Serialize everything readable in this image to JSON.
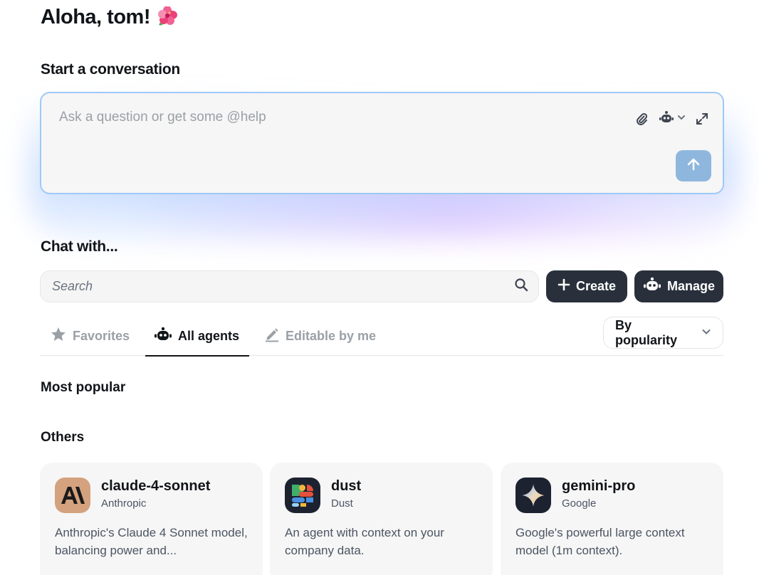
{
  "greeting": {
    "text": "Aloha, tom!",
    "emoji_icon": "hibiscus-icon"
  },
  "composer": {
    "section_title": "Start a conversation",
    "placeholder": "Ask a question or get some @help",
    "tools": [
      "paperclip-icon",
      "robot-icon",
      "chevron-down-icon",
      "expand-icon"
    ],
    "send_icon": "arrow-up-icon"
  },
  "chat_with": {
    "section_title": "Chat with...",
    "search_placeholder": "Search",
    "create_label": "Create",
    "manage_label": "Manage"
  },
  "tabs": [
    {
      "label": "Favorites",
      "icon": "star-icon",
      "active": false
    },
    {
      "label": "All agents",
      "icon": "robot-icon",
      "active": true
    },
    {
      "label": "Editable by me",
      "icon": "pencil-icon",
      "active": false
    }
  ],
  "sort": {
    "label": "By popularity"
  },
  "groups": {
    "most_popular": "Most popular",
    "others": "Others"
  },
  "agents": [
    {
      "name": "claude-4-sonnet",
      "vendor": "Anthropic",
      "description": "Anthropic's Claude 4 Sonnet model, balancing power and...",
      "avatar_color": "#d4a27f"
    },
    {
      "name": "dust",
      "vendor": "Dust",
      "description": "An agent with context on your company data.",
      "avatar_color": "#1c2230"
    },
    {
      "name": "gemini-pro",
      "vendor": "Google",
      "description": "Google's powerful large context model (1m context).",
      "avatar_color": "#1c2230"
    }
  ],
  "colors": {
    "dark_button": "#29303c",
    "composer_border": "#9ec9f5",
    "send_button": "#8fb7de"
  }
}
